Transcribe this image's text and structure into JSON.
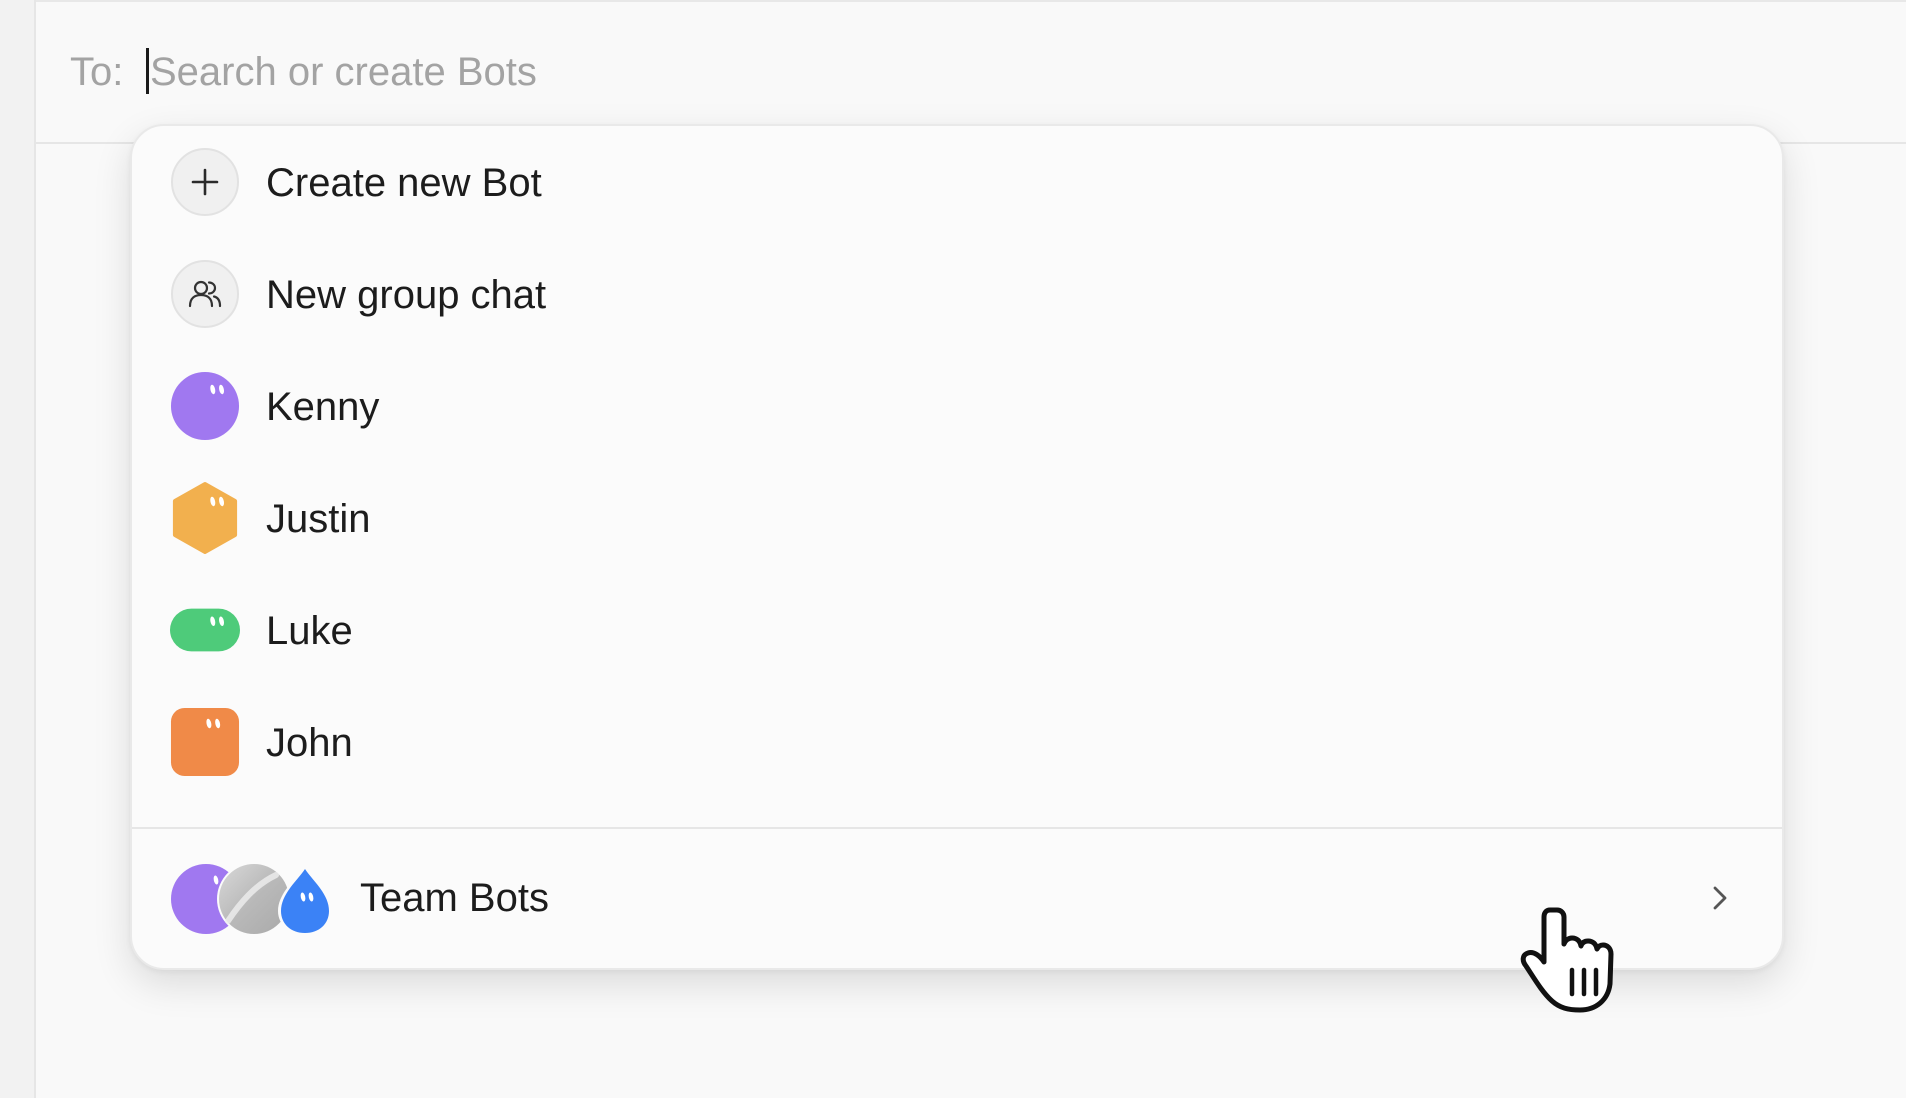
{
  "header": {
    "to_label": "To:",
    "search_placeholder": "Search or create Bots"
  },
  "dropdown": {
    "actions": [
      {
        "label": "Create new Bot",
        "icon": "plus-icon"
      },
      {
        "label": "New group chat",
        "icon": "group-icon"
      }
    ],
    "bots": [
      {
        "name": "Kenny",
        "avatar_shape": "circle",
        "color": "#a078f0"
      },
      {
        "name": "Justin",
        "avatar_shape": "hexagon",
        "color": "#f2b04e"
      },
      {
        "name": "Luke",
        "avatar_shape": "pill",
        "color": "#4ecb7a"
      },
      {
        "name": "John",
        "avatar_shape": "rounded-square",
        "color": "#f08a48"
      }
    ],
    "team": {
      "label": "Team Bots",
      "avatar_colors": [
        "#a078f0",
        "#c8c8c8",
        "#3b82f6"
      ],
      "icon": "chevron-right-icon"
    }
  },
  "colors": {
    "placeholder": "#a3a3a3",
    "text": "#1c1c1c",
    "border": "#e6e6e6"
  }
}
